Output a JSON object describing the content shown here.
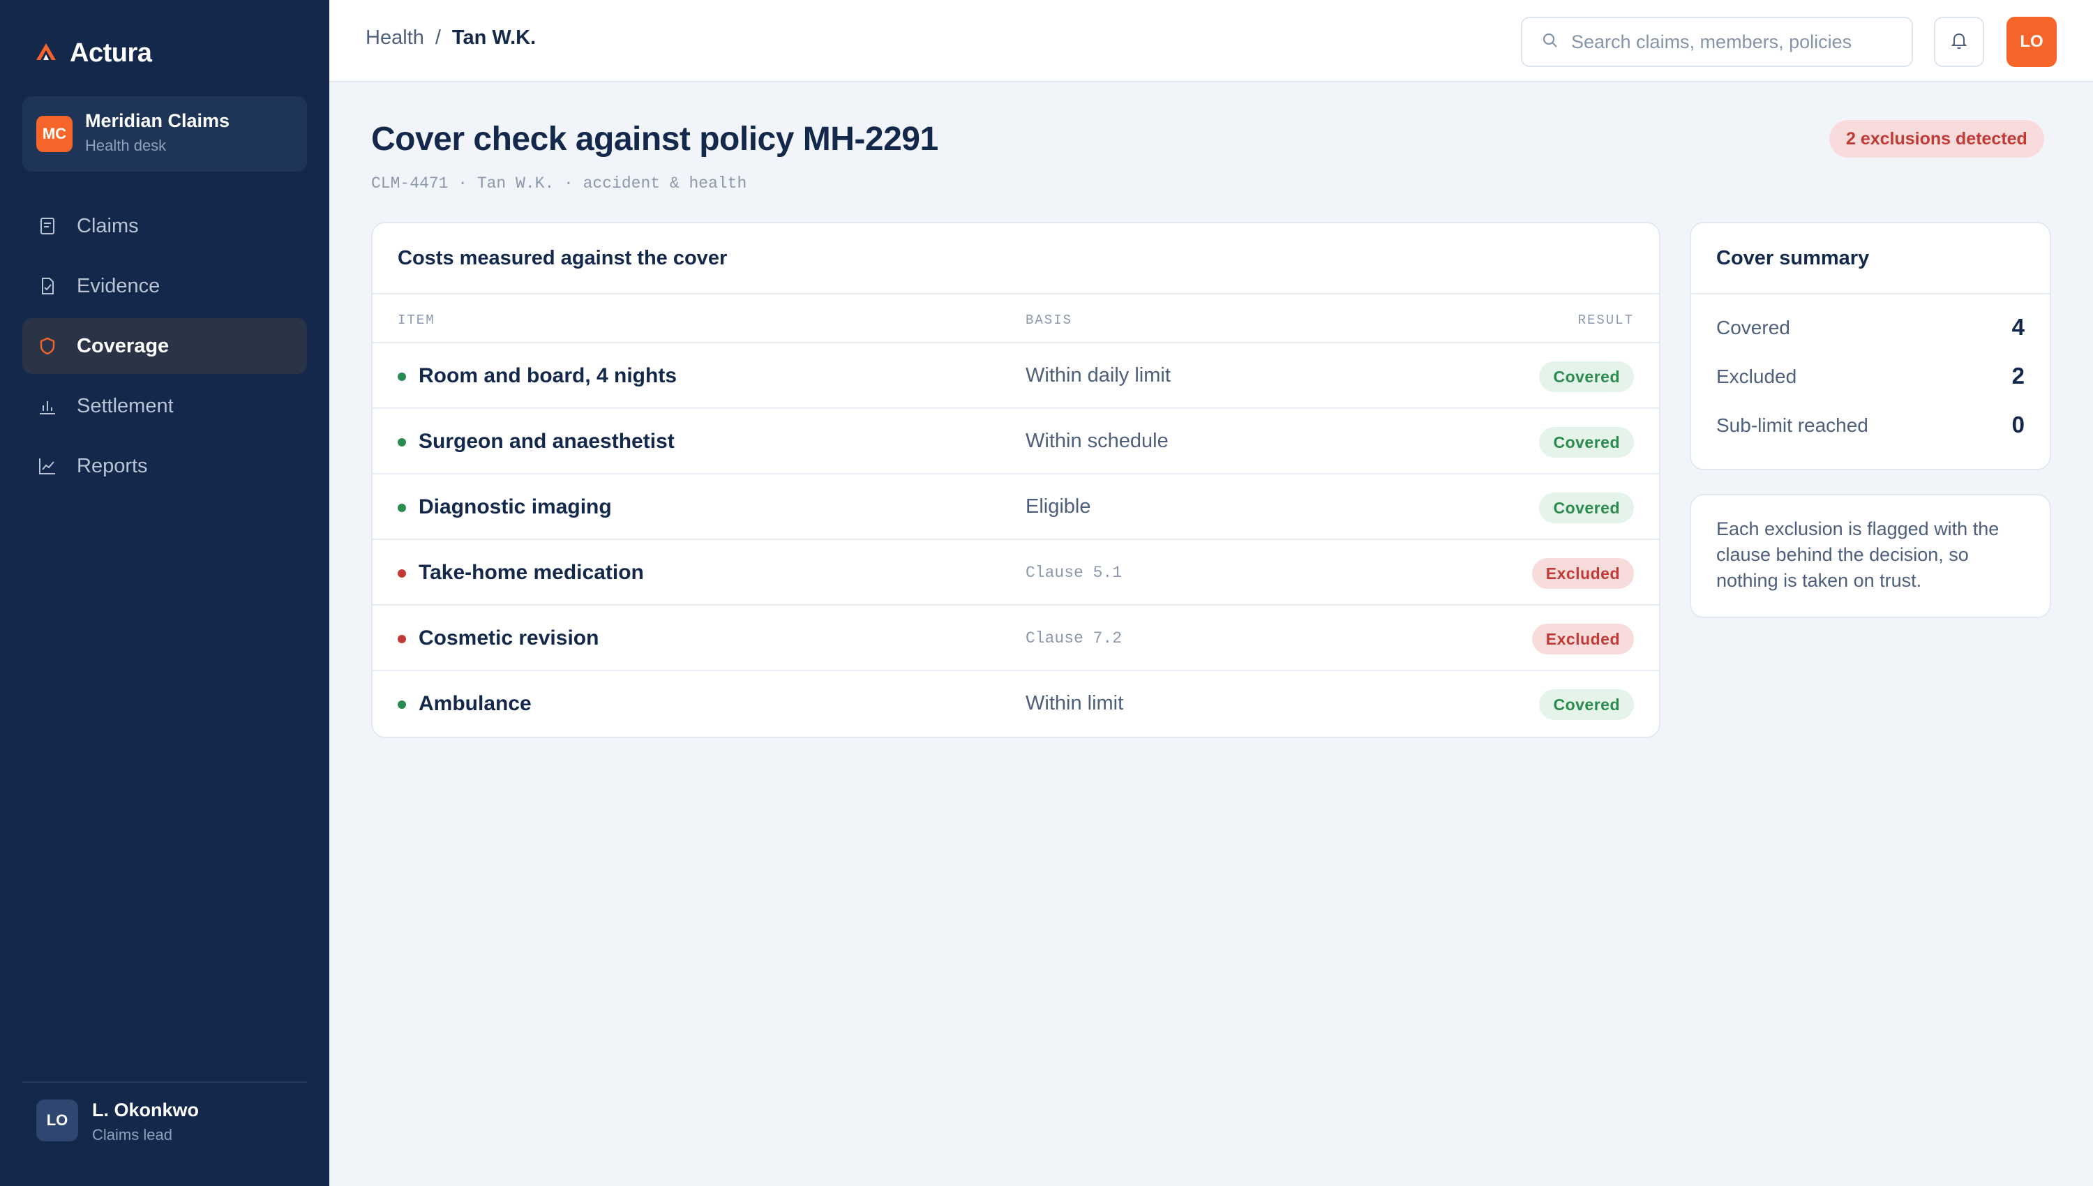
{
  "app": {
    "name": "Actura",
    "brand_color": "#f5652a",
    "sidebar_bg": "#13284a"
  },
  "workspace": {
    "initials": "MC",
    "name": "Meridian Claims",
    "subtitle": "Health desk"
  },
  "nav": {
    "items": [
      {
        "label": "Claims",
        "icon": "document-icon",
        "active": false
      },
      {
        "label": "Evidence",
        "icon": "file-check-icon",
        "active": false
      },
      {
        "label": "Coverage",
        "icon": "shield-icon",
        "active": true
      },
      {
        "label": "Settlement",
        "icon": "bar-chart-icon",
        "active": false
      },
      {
        "label": "Reports",
        "icon": "line-chart-icon",
        "active": false
      }
    ]
  },
  "user": {
    "initials": "LO",
    "name": "L. Okonkwo",
    "role": "Claims lead"
  },
  "topbar": {
    "breadcrumb": {
      "root": "Health",
      "separator": "/",
      "current": "Tan W.K."
    },
    "search": {
      "placeholder": "Search claims, members, policies",
      "value": ""
    },
    "avatar_initials": "LO"
  },
  "page": {
    "title": "Cover check against policy MH-2291",
    "meta": "CLM-4471 · Tan W.K. · accident & health",
    "alert": "2 exclusions detected"
  },
  "items_card": {
    "title": "Costs measured against the cover",
    "columns": {
      "item": "ITEM",
      "basis": "BASIS",
      "result": "RESULT"
    },
    "rows": [
      {
        "item": "Room and board, 4 nights",
        "basis": "Within daily limit",
        "result": "Covered",
        "status": "covered"
      },
      {
        "item": "Surgeon and anaesthetist",
        "basis": "Within schedule",
        "result": "Covered",
        "status": "covered"
      },
      {
        "item": "Diagnostic imaging",
        "basis": "Eligible",
        "result": "Covered",
        "status": "covered"
      },
      {
        "item": "Take-home medication",
        "basis": "Clause 5.1",
        "result": "Excluded",
        "status": "excluded"
      },
      {
        "item": "Cosmetic revision",
        "basis": "Clause 7.2",
        "result": "Excluded",
        "status": "excluded"
      },
      {
        "item": "Ambulance",
        "basis": "Within limit",
        "result": "Covered",
        "status": "covered"
      }
    ],
    "status_colors": {
      "covered": "#2b8a4e",
      "excluded": "#c23a36"
    }
  },
  "summary_card": {
    "title": "Cover summary",
    "rows": [
      {
        "label": "Covered",
        "value": "4"
      },
      {
        "label": "Excluded",
        "value": "2"
      },
      {
        "label": "Sub-limit reached",
        "value": "0"
      }
    ]
  },
  "note": {
    "text": "Each exclusion is flagged with the clause behind the decision, so nothing is taken on trust."
  }
}
